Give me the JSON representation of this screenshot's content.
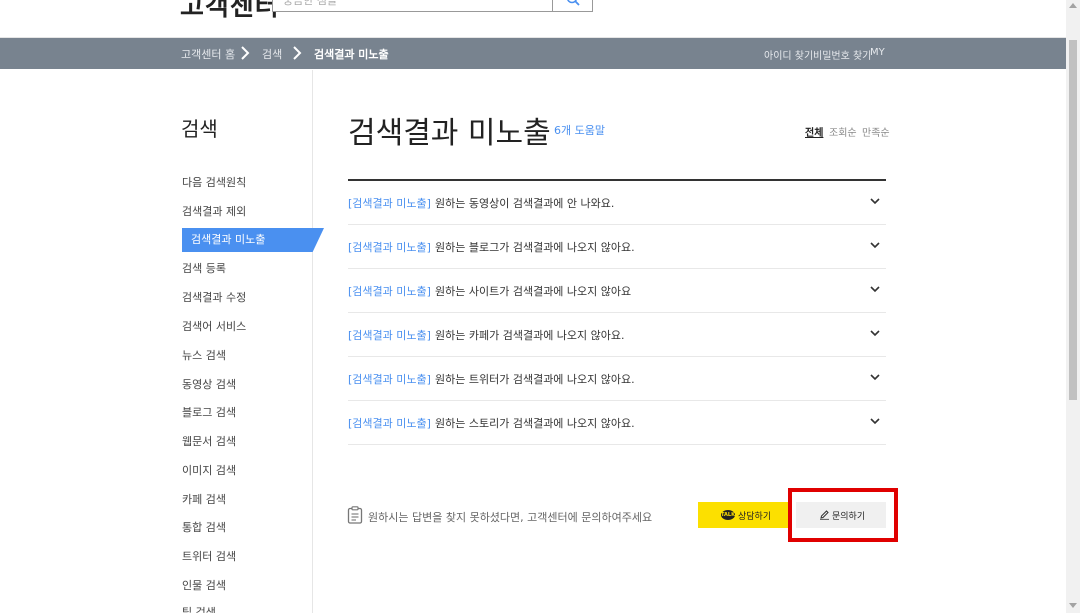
{
  "header": {
    "logo_text": "고객센터",
    "search_placeholder": "궁금한 점을"
  },
  "navbar": {
    "breadcrumbs": [
      "고객센터 홈",
      "검색",
      "검색결과 미노출"
    ],
    "right_links": [
      "아이디 찾기",
      "비밀번호 찾기",
      "MY"
    ]
  },
  "sidebar": {
    "title": "검색",
    "items": [
      {
        "label": "다음 검색원칙"
      },
      {
        "label": "검색결과 제외"
      },
      {
        "label": "검색결과 미노출",
        "active": true
      },
      {
        "label": "검색 등록"
      },
      {
        "label": "검색결과 수정"
      },
      {
        "label": "검색어 서비스"
      },
      {
        "label": "뉴스 검색"
      },
      {
        "label": "동영상 검색"
      },
      {
        "label": "블로그 검색"
      },
      {
        "label": "웹문서 검색"
      },
      {
        "label": "이미지 검색"
      },
      {
        "label": "카페 검색"
      },
      {
        "label": "통합 검색"
      },
      {
        "label": "트위터 검색"
      },
      {
        "label": "인물 검색"
      },
      {
        "label": "팁 검색"
      }
    ]
  },
  "main": {
    "title": "검색결과 미노출",
    "help_count": "6개 도움말",
    "sort_options": [
      "전체",
      "조회순",
      "만족순"
    ],
    "faq": [
      {
        "tag": "[검색결과 미노출]",
        "text": "원하는 동영상이 검색결과에 안 나와요."
      },
      {
        "tag": "[검색결과 미노출]",
        "text": "원하는 블로그가 검색결과에 나오지 않아요."
      },
      {
        "tag": "[검색결과 미노출]",
        "text": "원하는 사이트가 검색결과에 나오지 않아요"
      },
      {
        "tag": "[검색결과 미노출]",
        "text": "원하는 카페가 검색결과에 나오지 않아요."
      },
      {
        "tag": "[검색결과 미노출]",
        "text": "원하는 트위터가 검색결과에 나오지 않아요."
      },
      {
        "tag": "[검색결과 미노출]",
        "text": "원하는 스토리가 검색결과에 나오지 않아요."
      }
    ],
    "notice_text": "원하시는 답변을 찾지 못하셨다면, 고객센터에 문의하여주세요",
    "chat_button": "상담하기",
    "chat_badge": "TALK",
    "inquiry_button": "문의하기"
  },
  "colors": {
    "navbar": "#78838f",
    "accent_blue": "#4a90f0",
    "chat_yellow": "#fce000",
    "highlight_red": "#e00000"
  }
}
